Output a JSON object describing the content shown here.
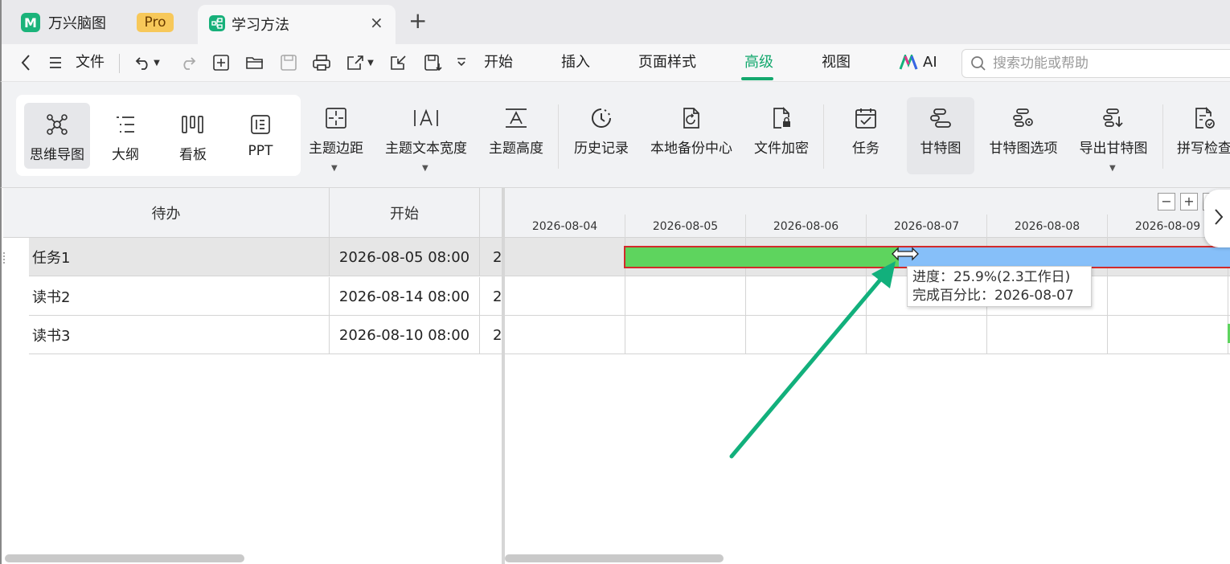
{
  "tabs": {
    "home_title": "万兴脑图",
    "pro_badge": "Pro",
    "doc_title": "学习方法",
    "close_glyph": "×",
    "add_glyph": "+"
  },
  "menubar": {
    "file_label": "文件",
    "items": [
      "开始",
      "插入",
      "页面样式",
      "高级",
      "视图"
    ],
    "active_item": "高级",
    "ai_label": "AI",
    "search_placeholder": "搜索功能或帮助"
  },
  "toolbar": {
    "views": [
      {
        "label": "思维导图",
        "icon": "mindmap-icon",
        "selected": true
      },
      {
        "label": "大纲",
        "icon": "outline-icon",
        "selected": false
      },
      {
        "label": "看板",
        "icon": "kanban-icon",
        "selected": false
      },
      {
        "label": "PPT",
        "icon": "ppt-icon",
        "selected": false
      }
    ],
    "tools": [
      {
        "label": "主题边距",
        "icon": "topic-margin-icon",
        "has_dropdown": true
      },
      {
        "label": "主题文本宽度",
        "icon": "topic-text-width-icon",
        "has_dropdown": true
      },
      {
        "label": "主题高度",
        "icon": "topic-height-icon",
        "has_dropdown": false
      },
      {
        "label": "历史记录",
        "icon": "history-icon",
        "has_dropdown": false
      },
      {
        "label": "本地备份中心",
        "icon": "local-backup-icon",
        "has_dropdown": false
      },
      {
        "label": "文件加密",
        "icon": "file-encrypt-icon",
        "has_dropdown": false
      },
      {
        "label": "任务",
        "icon": "task-icon",
        "has_dropdown": false
      },
      {
        "label": "甘特图",
        "icon": "gantt-icon",
        "selected": true
      },
      {
        "label": "甘特图选项",
        "icon": "gantt-options-icon",
        "has_dropdown": false
      },
      {
        "label": "导出甘特图",
        "icon": "export-gantt-icon",
        "has_dropdown": true
      },
      {
        "label": "拼写检查",
        "icon": "spell-check-icon",
        "has_dropdown": false
      }
    ]
  },
  "table": {
    "headers": [
      "待办",
      "开始"
    ],
    "rows": [
      {
        "task": "任务1",
        "start": "2026-08-05 08:00",
        "next": "2"
      },
      {
        "task": "读书2",
        "start": "2026-08-14 08:00",
        "next": "2"
      },
      {
        "task": "读书3",
        "start": "2026-08-10 08:00",
        "next": "2"
      }
    ]
  },
  "gantt": {
    "dates": [
      "2026-08-04",
      "2026-08-05",
      "2026-08-06",
      "2026-08-07",
      "2026-08-08",
      "2026-08-09"
    ],
    "zoom_out": "−",
    "zoom_in": "+",
    "progress_fraction": 0.259,
    "tooltip": {
      "progress_label": "进度：",
      "progress_value": "25.9%(2.3工作日)",
      "complete_label": "完成百分比：",
      "complete_value": "2026-08-07"
    }
  },
  "colors": {
    "accent": "#14a86e",
    "progress_done": "#5ed45e",
    "progress_remaining": "#86bff9",
    "selection_outline": "#d22a2a",
    "annotation_arrow": "#12b07c"
  }
}
